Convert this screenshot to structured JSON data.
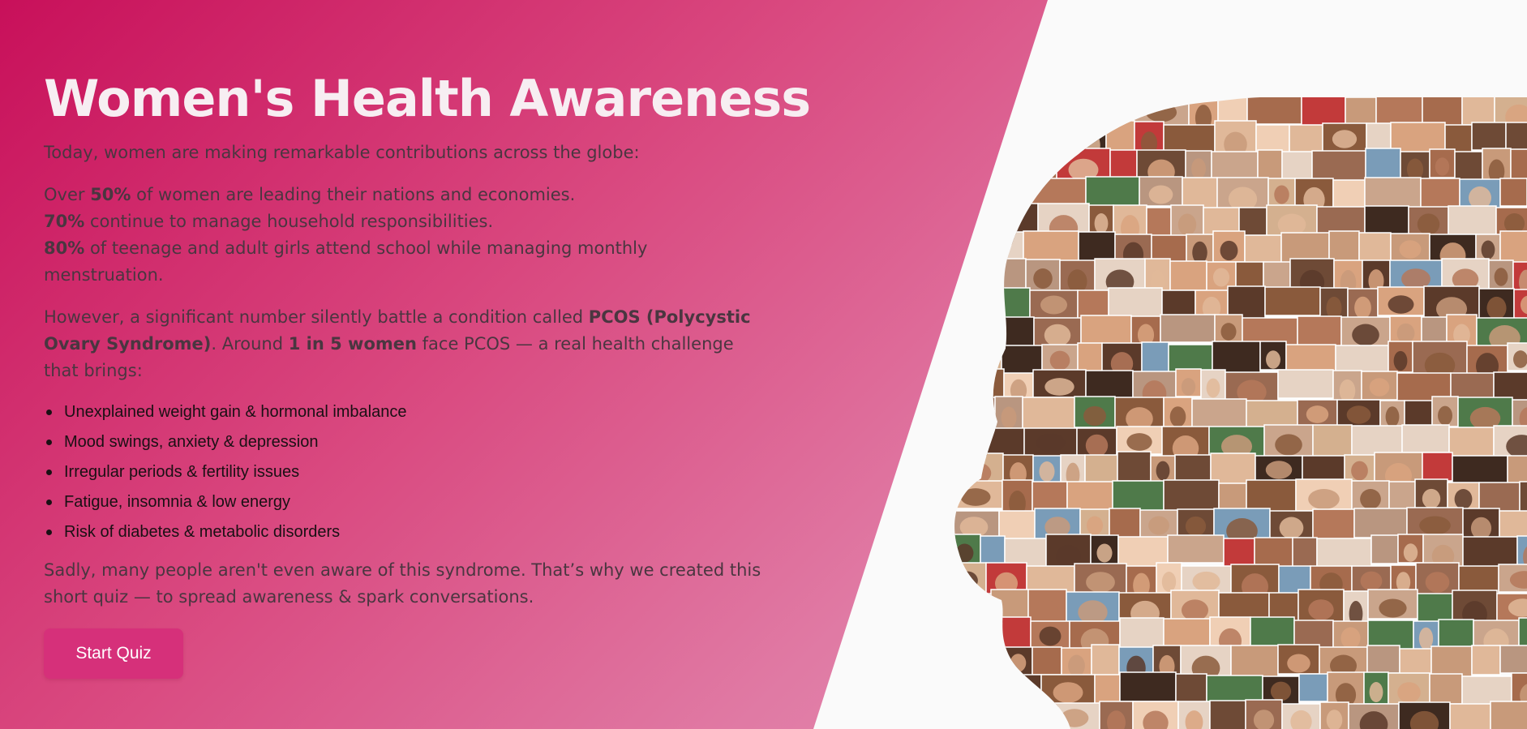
{
  "hero": {
    "title": "Women's Health Awareness",
    "intro": "Today, women are making remarkable contributions across the globe:",
    "stats": [
      {
        "value": "50%",
        "prefix": "Over ",
        "text": " of women are leading their nations and economies."
      },
      {
        "value": "70%",
        "prefix": "",
        "text": " continue to manage household responsibilities."
      },
      {
        "value": "80%",
        "prefix": "",
        "text": " of teenage and adult girls attend school while managing monthly menstruation."
      }
    ],
    "pcos": {
      "part1": "However, a significant number silently battle a condition called ",
      "condition": "PCOS (Polycystic Ovary Syndrome)",
      "part2": ". Around ",
      "ratio": "1 in 5 women",
      "part3": " face PCOS — a real health challenge that brings:"
    },
    "symptoms": [
      "Unexplained weight gain & hormonal imbalance",
      "Mood swings, anxiety & depression",
      "Irregular periods & fertility issues",
      "Fatigue, insomnia & low energy",
      "Risk of diabetes & metabolic disorders"
    ],
    "closing": "Sadly, many people aren't even aware of this syndrome. That’s why we created this short quiz — to spread awareness & spark conversations.",
    "cta_label": "Start Quiz"
  },
  "colors": {
    "gradient_start": "#c8105a",
    "gradient_end": "#eba0bf",
    "button": "#d6307a",
    "title": "#f7eef2"
  },
  "icons": {
    "collage": "faces-collage-head-silhouette"
  }
}
